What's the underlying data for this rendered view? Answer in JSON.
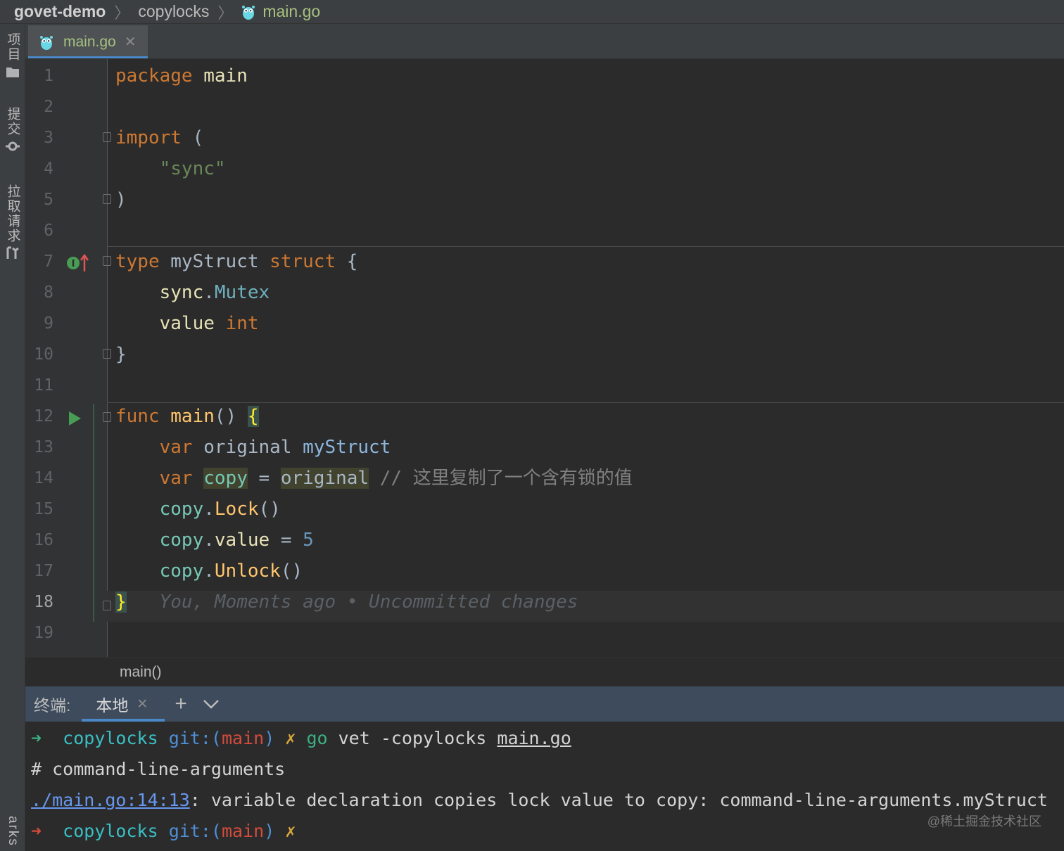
{
  "breadcrumb": {
    "project": "govet-demo",
    "folder": "copylocks",
    "file": "main.go"
  },
  "side_strip": {
    "project_label": "项目",
    "commit_label": "提交",
    "pull_requests_label": "拉取请求",
    "bookmarks_label": "arks"
  },
  "editor": {
    "tab_label": "main.go",
    "line_numbers": [
      "1",
      "2",
      "3",
      "4",
      "5",
      "6",
      "7",
      "8",
      "9",
      "10",
      "11",
      "12",
      "13",
      "14",
      "15",
      "16",
      "17",
      "18",
      "19"
    ],
    "current_line": 18,
    "code": {
      "l1_kw": "package",
      "l1_name": "main",
      "l3_kw": "import",
      "l3_paren": "(",
      "l4_str": "\"sync\"",
      "l5_paren": ")",
      "l7_kw": "type",
      "l7_name": "myStruct",
      "l7_kw2": "struct",
      "l7_brace": "{",
      "l8_pkg": "sync",
      "l8_dot": ".",
      "l8_type": "Mutex",
      "l9_field": "value",
      "l9_type": "int",
      "l10_brace": "}",
      "l12_kw": "func",
      "l12_name": "main",
      "l12_parens": "()",
      "l12_brace": "{",
      "l13_kw": "var",
      "l13_name": "original",
      "l13_type": "myStruct",
      "l14_kw": "var",
      "l14_name": "copy",
      "l14_eq": "=",
      "l14_value": "original",
      "l14_comment": "// 这里复制了一个含有锁的值",
      "l15_var": "copy",
      "l15_dot": ".",
      "l15_method": "Lock",
      "l15_parens": "()",
      "l16_var": "copy",
      "l16_dot": ".",
      "l16_field": "value",
      "l16_eq": "=",
      "l16_num": "5",
      "l17_var": "copy",
      "l17_dot": ".",
      "l17_method": "Unlock",
      "l17_parens": "()",
      "l18_brace": "}",
      "l18_blame": "You, Moments ago • Uncommitted changes"
    },
    "footer_breadcrumb": "main()"
  },
  "terminal": {
    "title": "终端:",
    "tab_label": "本地",
    "new_label": "+",
    "lines": {
      "l1_arrow": "➜",
      "l1_dir": "copylocks",
      "l1_git": "git:(",
      "l1_branch": "main",
      "l1_git_close": ")",
      "l1_dirty": "✗",
      "l1_cmd_go": "go",
      "l1_cmd_rest": "vet -copylocks",
      "l1_cmd_file": "main.go",
      "l2": "# command-line-arguments",
      "l3_link": "./main.go:14:13",
      "l3_rest": ": variable declaration copies lock value to copy: command-line-arguments.myStruct",
      "l4_arrow": "➜",
      "l4_dir": "copylocks",
      "l4_git": "git:(",
      "l4_branch": "main",
      "l4_git_close": ")",
      "l4_dirty": "✗"
    }
  },
  "watermark": "@稀土掘金技术社区",
  "colors": {
    "background": "#2b2b2b",
    "keyword": "#cc7832",
    "string": "#6a8759",
    "function": "#ffc66d",
    "accent": "#4a88c7"
  }
}
